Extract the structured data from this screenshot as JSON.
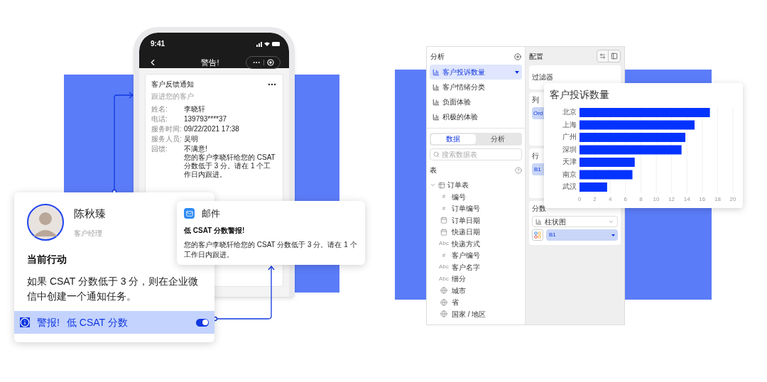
{
  "phone": {
    "time": "9:41",
    "nav_title": "警告!",
    "card": {
      "title": "客户反馈通知",
      "subtitle": "跟进您的客户",
      "fields": [
        {
          "label": "姓名:",
          "value": "李晓轩"
        },
        {
          "label": "电话:",
          "value": "139793****37"
        },
        {
          "label": "服务时间:",
          "value": "09/22/2021 17:38"
        },
        {
          "label": "服务人员:",
          "value": "吴明"
        },
        {
          "label": "回馈:",
          "value": "不满意!",
          "note": "您的客户李晓轩给您的 CSAT 分数低于 3 分。请在 1 个工作日内跟进。"
        }
      ]
    }
  },
  "contact_card": {
    "name": "陈秋臻",
    "role": "客户经理",
    "section_title": "当前行动",
    "description": "如果 CSAT 分数低于 3 分，则在企业微信中创建一个通知任务。",
    "alert": {
      "label": "警报!",
      "text": "低 CSAT 分数",
      "on": true
    }
  },
  "mail": {
    "app": "邮件",
    "title": "低 CSAT 分数警报!",
    "body": "您的客户李晓轩给您的 CSAT 分数低于 3 分。请在 1 个工作日内跟进。"
  },
  "analysis_panel": {
    "title": "分析",
    "items": [
      {
        "label": "客户投诉数量",
        "selected": true
      },
      {
        "label": "客户情绪分类",
        "selected": false
      },
      {
        "label": "负面体验",
        "selected": false
      },
      {
        "label": "积极的体验",
        "selected": false
      }
    ],
    "tabs": [
      {
        "label": "数据",
        "selected": true
      },
      {
        "label": "分析",
        "selected": false
      }
    ],
    "search": {
      "placeholder": "搜索数据表"
    },
    "section_title": "表",
    "tree": [
      {
        "label": "订单表",
        "expanded": true,
        "children": [
          {
            "label": "编号",
            "kind": "number",
            "type_label": "#"
          },
          {
            "label": "订单编号",
            "kind": "number",
            "type_label": "#"
          },
          {
            "label": "订单日期",
            "kind": "date"
          },
          {
            "label": "快递日期",
            "kind": "date"
          },
          {
            "label": "快递方式",
            "kind": "text",
            "type_label": "Abc"
          },
          {
            "label": "客户编号",
            "kind": "number",
            "type_label": "#"
          },
          {
            "label": "客户名字",
            "kind": "text",
            "type_label": "Abc"
          },
          {
            "label": "细分",
            "kind": "text",
            "type_label": "Abc"
          },
          {
            "label": "城市",
            "kind": "geo"
          },
          {
            "label": "省",
            "kind": "geo"
          },
          {
            "label": "国家 / 地区",
            "kind": "geo"
          }
        ]
      }
    ]
  },
  "config_panel": {
    "title": "配置",
    "filter_label": "过滤器",
    "columns_label": "列",
    "column_chip": "Ord",
    "rows_label": "行",
    "row_chip": "B1",
    "score_label": "分数",
    "chart_type": "柱状图",
    "field_chip": "B1"
  },
  "chart_card": {
    "title": "客户投诉数量",
    "chart_data": {
      "type": "bar",
      "orientation": "horizontal",
      "categories": [
        "北京",
        "上海",
        "广州",
        "深圳",
        "天津",
        "南京",
        "武汉"
      ],
      "grid": true,
      "series": [
        {
          "color": "#0433ff",
          "values": [
            17,
            15,
            13.8,
            13.3,
            7.2,
            6.9,
            3.6
          ]
        }
      ],
      "xlim": [
        0,
        20
      ],
      "xticks": [
        0,
        2,
        4,
        6,
        8,
        10,
        12,
        14,
        16,
        18,
        20
      ]
    }
  }
}
